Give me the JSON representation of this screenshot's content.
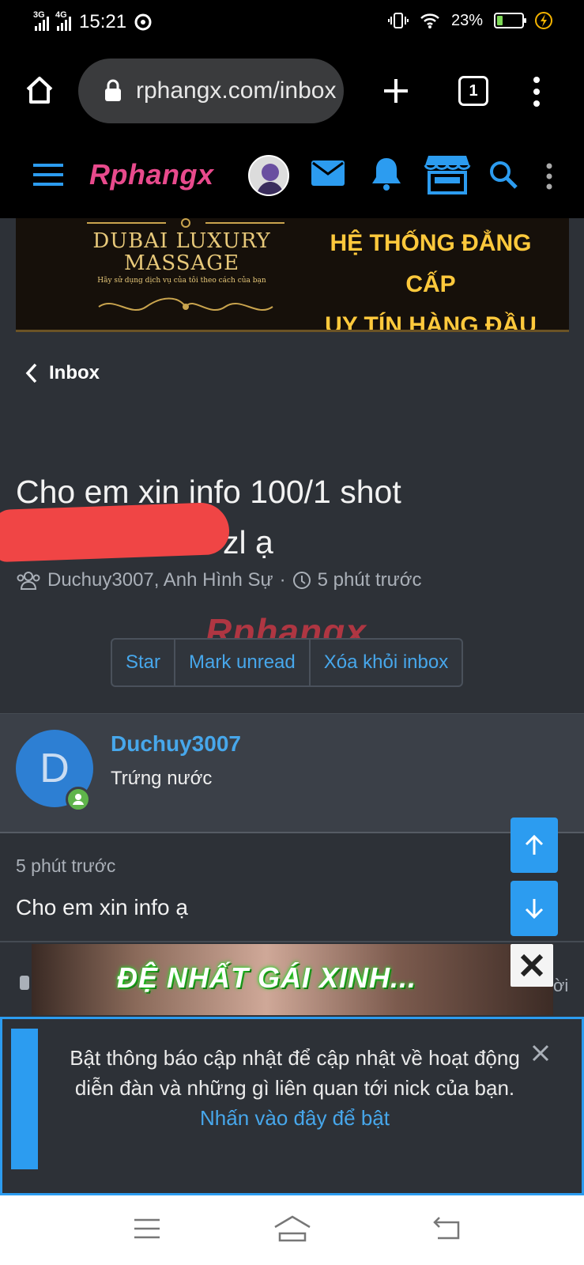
{
  "status": {
    "net1": "3G",
    "net2": "4G",
    "time": "15:21",
    "battery": "23%",
    "battery_level": 0.23
  },
  "browser": {
    "url": "rphangx.com/inbox",
    "tab_count": "1"
  },
  "site": {
    "logo": "Rphangx"
  },
  "banner": {
    "left_line1": "DUBAI LUXURY",
    "left_line2": "MASSAGE",
    "left_tagline": "Hãy sử dụng dịch vụ của tôi theo cách của bạn",
    "right_line1": "HỆ THỐNG ĐẲNG CẤP",
    "right_line2": "UY TÍN HÀNG ĐẦU"
  },
  "nav": {
    "back_label": "Inbox"
  },
  "conversation": {
    "title_line1": "Cho em xin info 100/1 shot",
    "title_line2_tail": "zl ạ",
    "participants": "Duchuy3007, Anh Hình Sự",
    "separator": "·",
    "time": "5 phút trước",
    "watermark": "Rphangx"
  },
  "actions": {
    "star": "Star",
    "mark_unread": "Mark unread",
    "remove": "Xóa khỏi inbox"
  },
  "message": {
    "avatar_letter": "D",
    "username": "Duchuy3007",
    "rank": "Trứng nước",
    "time": "5 phút trước",
    "text": "Cho em xin info ạ"
  },
  "ad": {
    "text": "ĐỆ NHẤT GÁI XINH...",
    "peek_right": "ời"
  },
  "notice": {
    "line1": "Bật thông báo cập nhật để cập nhật về hoạt động",
    "line2": "diễn đàn và những gì liên quan tới nick của bạn.",
    "link": "Nhấn vào đây để bật"
  },
  "colors": {
    "accent": "#2c9cf0",
    "link": "#47a7eb",
    "background": "#2d3137",
    "online": "#5fb44b",
    "redaction": "#f04545"
  }
}
